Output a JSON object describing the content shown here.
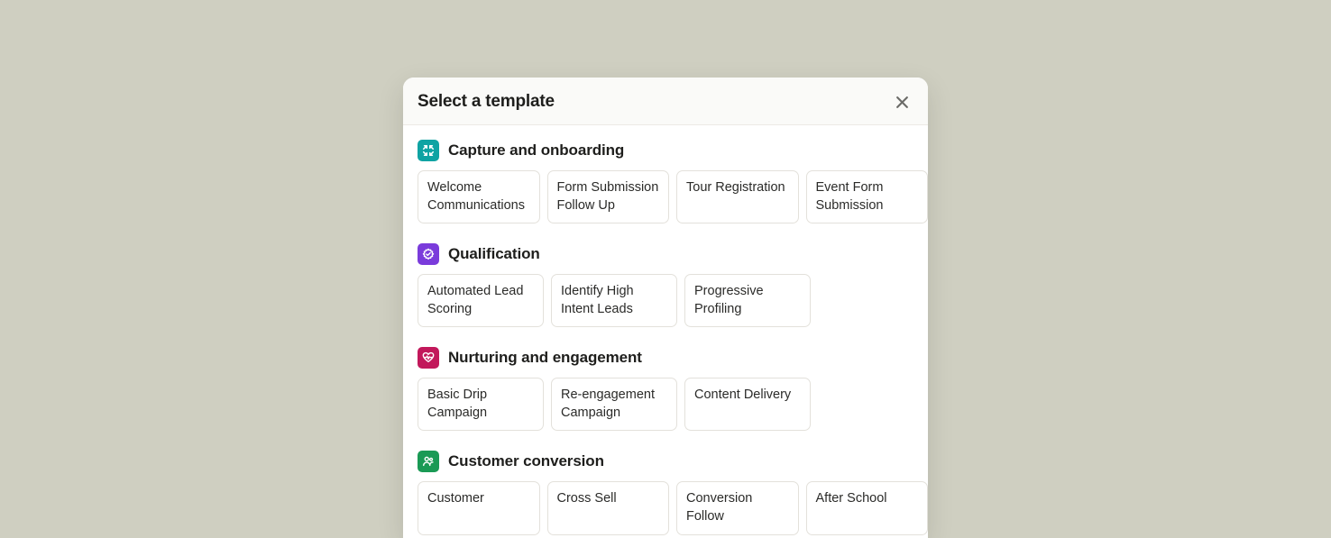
{
  "modal": {
    "title": "Select a template"
  },
  "sections": [
    {
      "icon": "capture",
      "iconColor": "ic-teal",
      "title": "Capture and onboarding",
      "cards": [
        "Welcome Communications",
        "Form Submission Follow Up",
        "Tour Registration",
        "Event Form Submission"
      ]
    },
    {
      "icon": "qualification",
      "iconColor": "ic-purple",
      "title": "Qualification",
      "cards": [
        "Automated Lead Scoring",
        "Identify High Intent Leads",
        "Progressive Profiling"
      ]
    },
    {
      "icon": "nurturing",
      "iconColor": "ic-pink",
      "title": "Nurturing and engagement",
      "cards": [
        "Basic Drip Campaign",
        "Re-engagement Campaign",
        "Content Delivery"
      ]
    },
    {
      "icon": "conversion",
      "iconColor": "ic-green",
      "title": "Customer conversion",
      "cards": [
        "Customer",
        "Cross Sell",
        "Conversion Follow",
        "After School"
      ]
    }
  ]
}
